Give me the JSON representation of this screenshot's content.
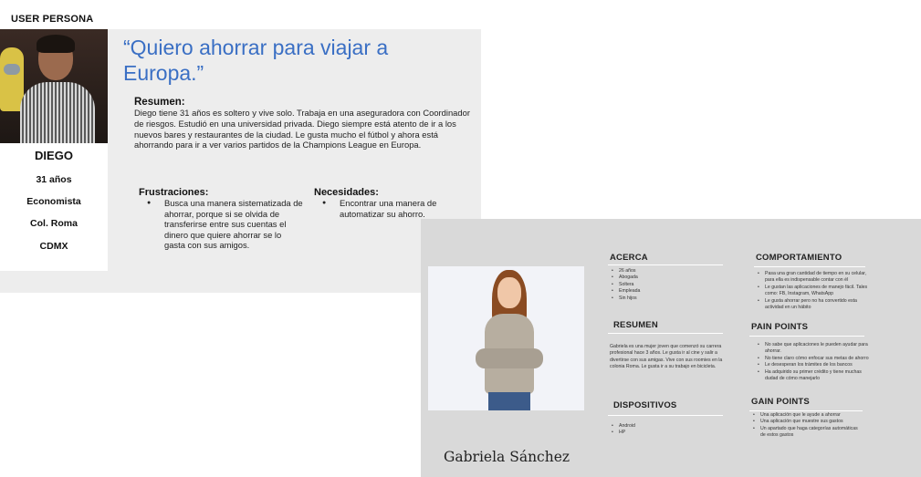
{
  "slide_title": "USER PERSONA",
  "persona1": {
    "name": "DIEGO",
    "age": "31 años",
    "occupation": "Economista",
    "neighborhood": "Col. Roma",
    "city": "CDMX",
    "quote": "“Quiero ahorrar para viajar a Europa.”",
    "summary_title": "Resumen:",
    "summary_text": "Diego tiene 31 años es soltero y vive solo. Trabaja en una aseguradora con Coordinador de riesgos.  Estudió en una universidad privada. Diego siempre está atento de ir a los nuevos bares y restaurantes de la ciudad. Le gusta mucho el fútbol y ahora está ahorrando para ir a ver varios partidos de la Champions League en Europa.",
    "frustrations_title": "Frustraciones:",
    "frustrations": [
      "Busca una manera sistematizada de ahorrar, porque si se olvida de transferirse entre sus cuentas el dinero que quiere ahorrar se lo gasta con sus amigos."
    ],
    "needs_title": "Necesidades:",
    "needs": [
      "Encontrar una manera de automatizar su ahorro."
    ]
  },
  "persona2": {
    "name": "Gabriela Sánchez",
    "about_title": "ACERCA",
    "about": [
      "26 años",
      "Abogada",
      "Soltera",
      "Empleada",
      "Sin hijos"
    ],
    "summary_title": "RESUMEN",
    "summary_text": "Gabriela es una mujer joven que comenzó su carrera profesional hace 3 años. Le gusta ir al cine y salir a divertirse con sus amigas. Vive con sus roomies en la colonia Roma. Le gusta ir a su trabajo en bicicleta.",
    "devices_title": "DISPOSITIVOS",
    "devices": [
      "Android",
      "HP"
    ],
    "behavior_title": "COMPORTAMIENTO",
    "behavior": [
      "Pasa una gran cantidad de tiempo en su celular, para ella es indispensable contar con él",
      "Le gustan las aplicaciones de manejo fácil. Tales como: FB, Instagram, WhatsApp",
      "Le gusta ahorrar pero no ha convertido esta actividad en un hábito"
    ],
    "pain_title": "PAIN POINTS",
    "pain_points": [
      "No sabe que aplicaciones le pueden ayudar para ahorrar.",
      "No tiene claro cómo enfocar sus metas de ahorro",
      "Le desesperan los trámites de los bancos",
      "Ha adquirido su primer crédito y tiene muchas dudad de cómo manejarlo"
    ],
    "gain_title": "GAIN POINTS",
    "gain_points": [
      "Una aplicación que le ayude a ahorrar",
      "Una aplicación que muestre sus gastos",
      "Un apartado que haga categorías automáticas de estos gastos"
    ]
  },
  "colors": {
    "quote": "#3a6fc4",
    "card1_bg": "#ededed",
    "card2_bg": "#d9d9d9"
  }
}
